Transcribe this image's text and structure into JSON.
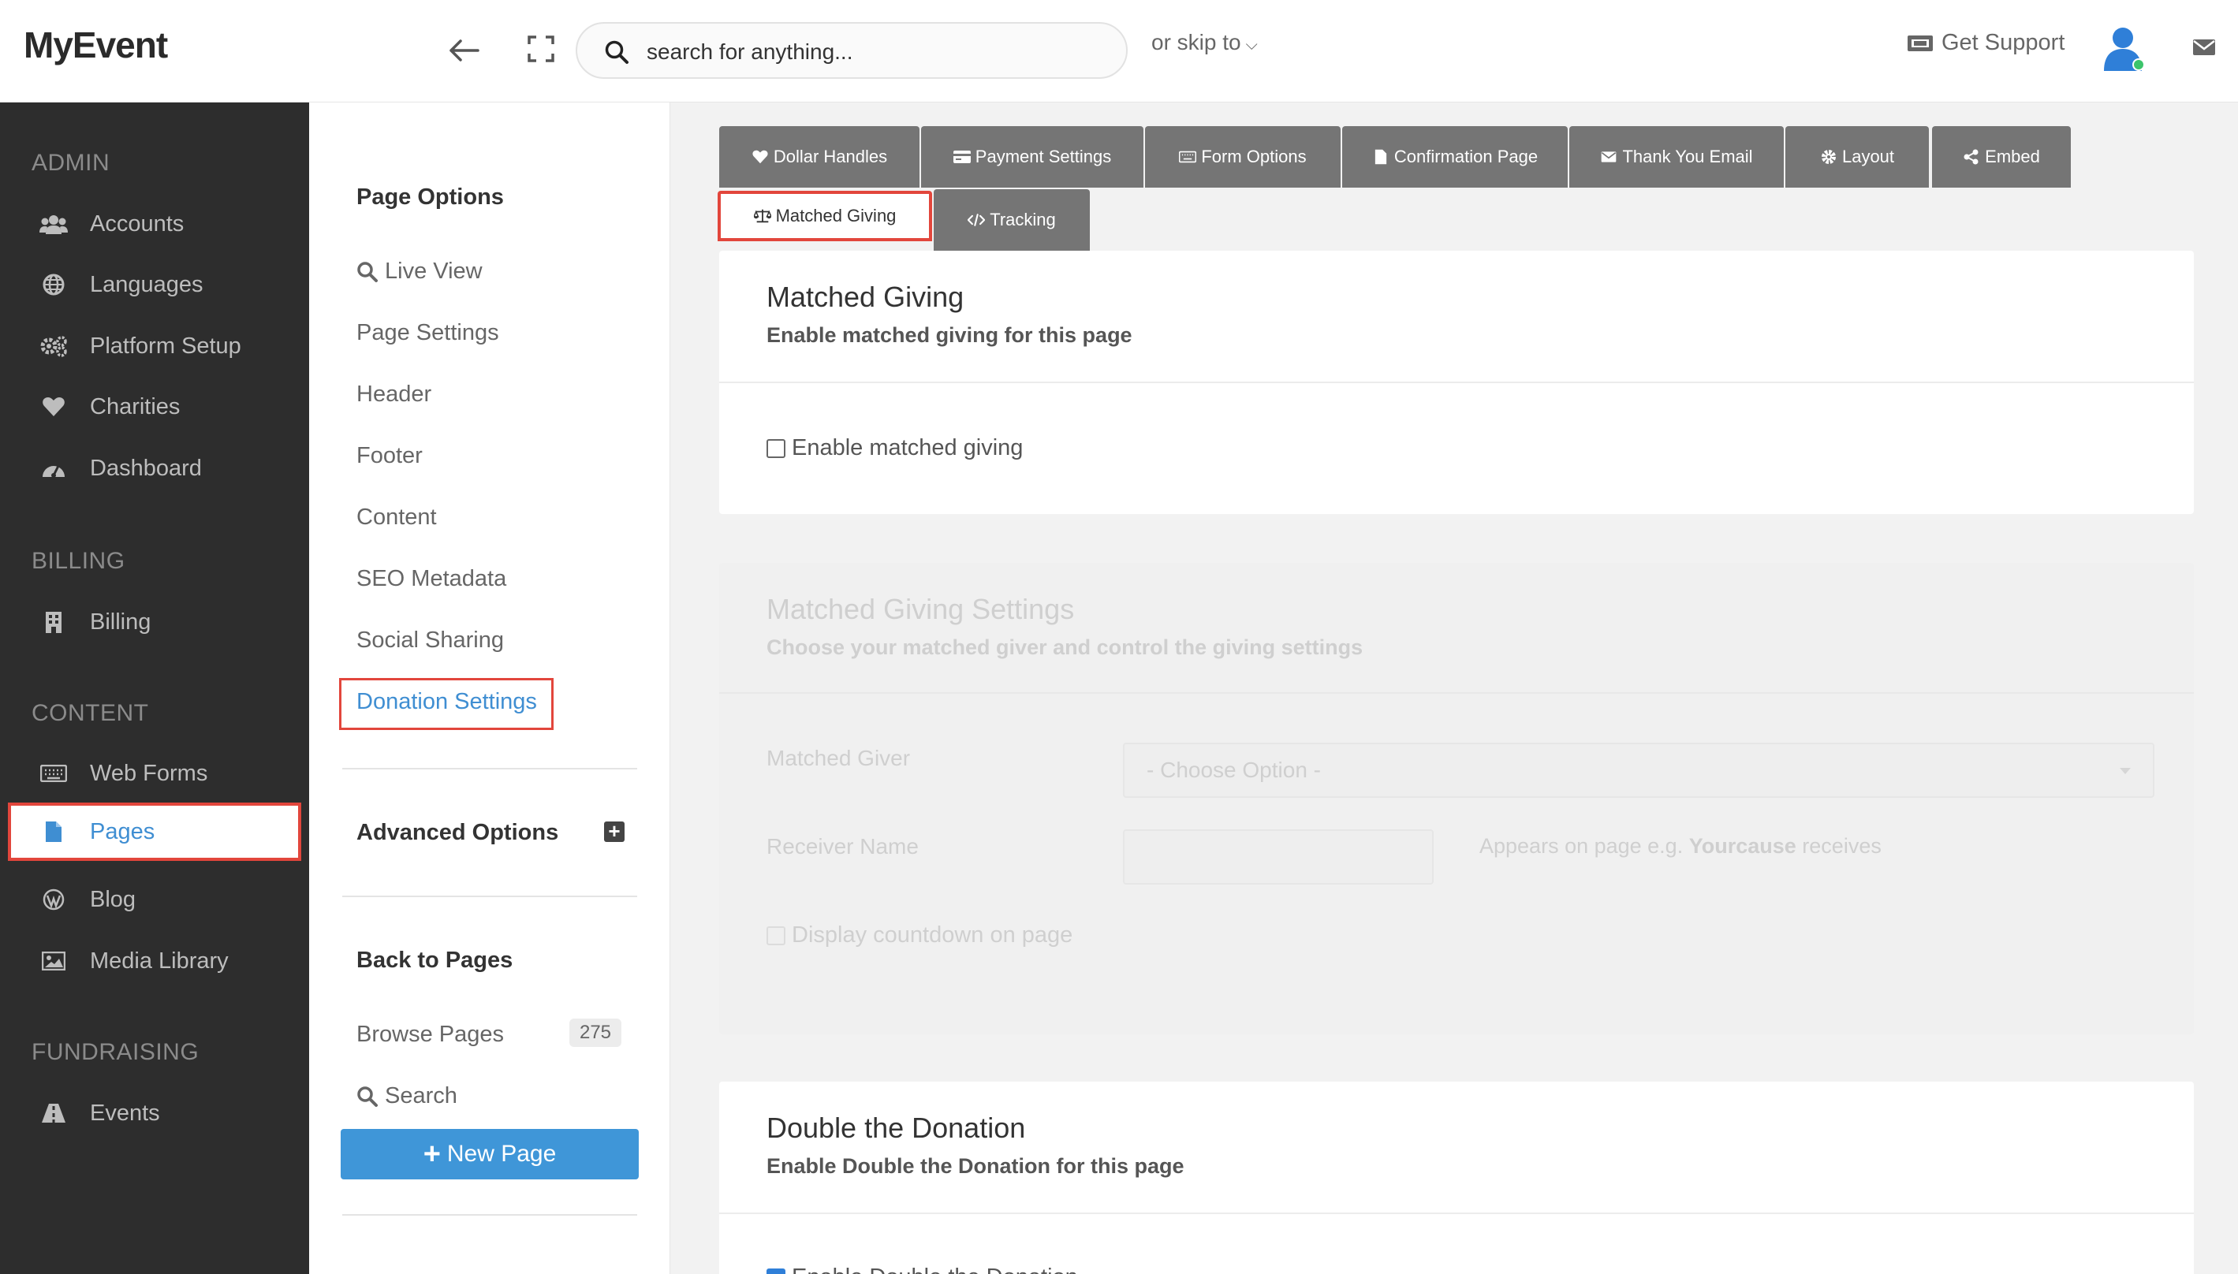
{
  "app": {
    "logo": "MyEvent"
  },
  "topbar": {
    "search_placeholder": "search for anything...",
    "skip_to": "or skip to",
    "support": "Get Support"
  },
  "sidebar": {
    "sections": [
      {
        "title": "ADMIN",
        "items": [
          "Accounts",
          "Languages",
          "Platform Setup",
          "Charities",
          "Dashboard"
        ]
      },
      {
        "title": "BILLING",
        "items": [
          "Billing"
        ]
      },
      {
        "title": "CONTENT",
        "items": [
          "Web Forms",
          "Pages",
          "Blog",
          "Media Library"
        ]
      },
      {
        "title": "FUNDRAISING",
        "items": [
          "Events"
        ]
      }
    ],
    "active": "Pages"
  },
  "subnav": {
    "page_options": "Page Options",
    "items": [
      "Live View",
      "Page Settings",
      "Header",
      "Footer",
      "Content",
      "SEO Metadata",
      "Social Sharing",
      "Donation Settings"
    ],
    "advanced_options": "Advanced Options",
    "back_to_pages": "Back to Pages",
    "browse_pages": "Browse Pages",
    "browse_count": "275",
    "search": "Search",
    "new_page": "New Page"
  },
  "tabs": {
    "row1": [
      "Dollar Handles",
      "Payment Settings",
      "Form Options",
      "Confirmation Page",
      "Thank You Email",
      "Layout",
      "Embed"
    ],
    "row2": [
      "Matched Giving",
      "Tracking"
    ],
    "active": "Matched Giving"
  },
  "matched_giving": {
    "title": "Matched Giving",
    "subtitle": "Enable matched giving for this page",
    "checkbox": "Enable matched giving",
    "checked": false
  },
  "matched_settings": {
    "title": "Matched Giving Settings",
    "subtitle": "Choose your matched giver and control the giving settings",
    "giver_label": "Matched Giver",
    "giver_value": "- Choose Option -",
    "receiver_label": "Receiver Name",
    "receiver_note_prefix": "Appears on page e.g.",
    "receiver_note_bold": "Yourcause",
    "receiver_note_suffix": "receives",
    "countdown": "Display countdown on page"
  },
  "double_donation": {
    "title": "Double the Donation",
    "subtitle": "Enable Double the Donation for this page",
    "checkbox": "Enable Double the Donation",
    "checked": true
  },
  "colors": {
    "accent": "#3f8ed2",
    "highlight": "#e2463c",
    "sidebar": "#2d2d2d",
    "tab": "#757575"
  }
}
